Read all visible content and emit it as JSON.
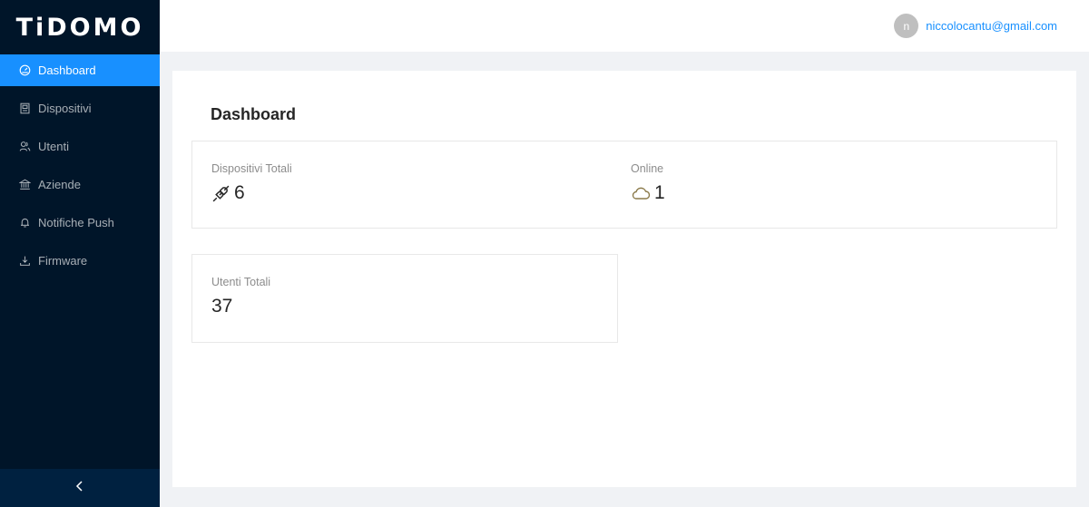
{
  "brand": {
    "logo_text": "TiDOMO"
  },
  "sidebar": {
    "items": [
      {
        "label": "Dashboard",
        "icon": "dashboard-icon",
        "active": true
      },
      {
        "label": "Dispositivi",
        "icon": "device-icon"
      },
      {
        "label": "Utenti",
        "icon": "users-icon"
      },
      {
        "label": "Aziende",
        "icon": "bank-icon"
      },
      {
        "label": "Notifiche Push",
        "icon": "bell-icon"
      },
      {
        "label": "Firmware",
        "icon": "download-icon"
      }
    ],
    "collapse_glyph": "<"
  },
  "header": {
    "avatar_initial": "n",
    "user_email": "niccolocantu@gmail.com"
  },
  "main": {
    "title": "Dashboard",
    "stats": {
      "devices": {
        "title": "Dispositivi Totali",
        "value": "6",
        "icon": "plug-icon"
      },
      "online": {
        "title": "Online",
        "value": "1",
        "icon": "cloud-icon"
      },
      "users": {
        "title": "Utenti Totali",
        "value": "37"
      }
    }
  },
  "colors": {
    "sidebar_bg": "#001529",
    "accent": "#1890ff",
    "cloud_icon": "#8b7a4a"
  }
}
